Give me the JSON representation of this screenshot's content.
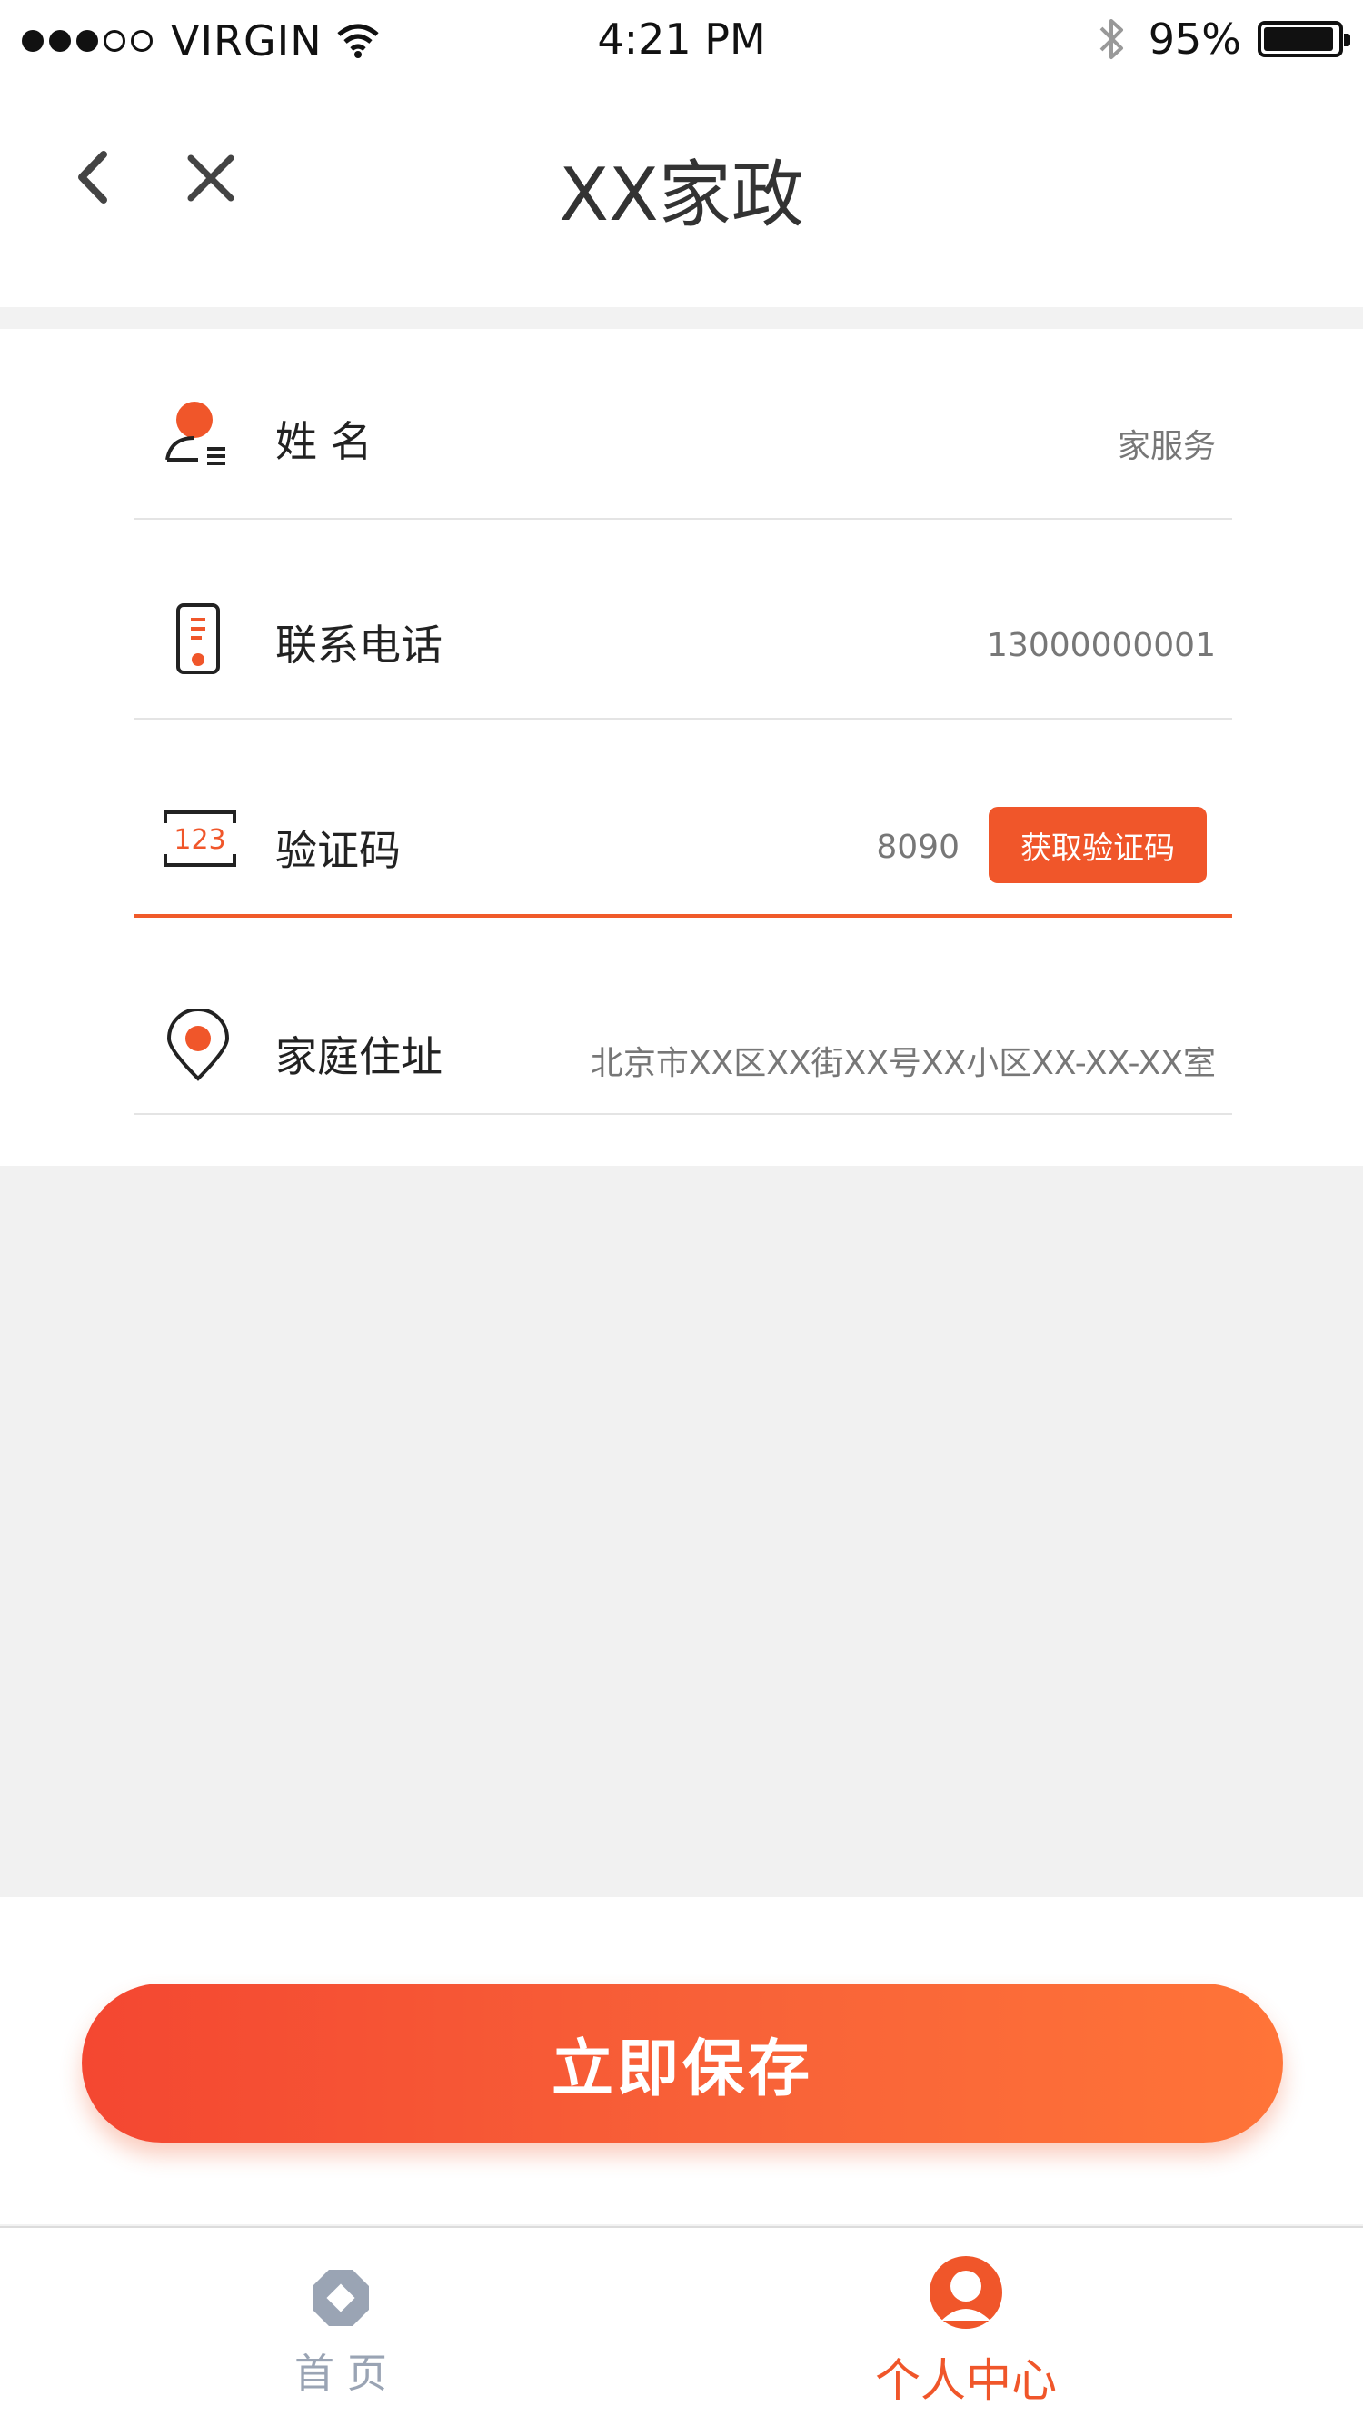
{
  "status_bar": {
    "carrier": "VIRGIN",
    "time": "4:21 PM",
    "battery": "95%",
    "battery_level": 0.95,
    "signal_bars": 3,
    "signal_total": 5
  },
  "nav": {
    "title": "XX家政",
    "back_icon": "chevron-left-icon",
    "close_icon": "close-icon"
  },
  "form": {
    "name": {
      "label": "姓    名",
      "value": "家服务",
      "icon": "user-card-icon"
    },
    "phone": {
      "label": "联系电话",
      "value": "13000000001",
      "icon": "phone-icon"
    },
    "code": {
      "label": "验证码",
      "value": "8090",
      "icon_text": "123",
      "button": "获取验证码",
      "icon": "code-icon"
    },
    "address": {
      "label": "家庭住址",
      "value": "北京市XX区XX街XX号XX小区XX-XX-XX室",
      "icon": "location-pin-icon"
    }
  },
  "save_button": "立即保存",
  "tabs": [
    {
      "label": "首    页",
      "icon": "home-octagon-icon",
      "active": false
    },
    {
      "label": "个人中心",
      "icon": "user-avatar-icon",
      "active": true
    }
  ],
  "colors": {
    "accent": "#f0562a",
    "tab_inactive": "#9aa4b4",
    "page_background": "#f1f1f1"
  }
}
